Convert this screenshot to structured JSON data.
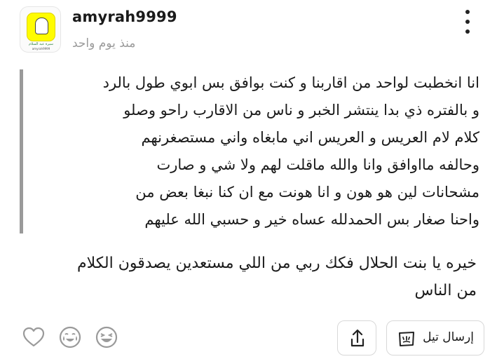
{
  "post": {
    "avatar": {
      "caption_line1": "سيرة عبد السلام",
      "caption_line2": "amyrah9999"
    },
    "username": "amyrah9999",
    "time_ago": "منذ يوم واحد",
    "quote_lines": [
      "انا انخطبت لواحد من اقاربنا و كنت بوافق بس ابوي طول بالرد",
      "و بالفتره ذي بدا ينتشر الخبر و ناس من الاقارب راحو وصلو",
      "كلام  لام العريس  و  العريس اني مابغاه واني مستصغرنهم",
      "وحالفه  مااوافق وانا والله ماقلت لهم ولا شي و صارت",
      "مشحانات لين هو هون و انا هونت مع ان كنا نبغا بعض من",
      "واحنا صغار بس الحمدلله عساه خير و حسبي الله عليهم"
    ],
    "reply_lines": [
      "خيره يا بنت الحلال فكك ربي من اللي مستعدين يصدقون الكلام",
      "من الناس"
    ]
  },
  "actions": {
    "send_tell_label": "إرسال تيل",
    "icons": [
      "heart-icon",
      "crying-laughing-icon",
      "laughing-icon",
      "share-icon",
      "tell-note-icon",
      "more-vertical-icon"
    ]
  }
}
